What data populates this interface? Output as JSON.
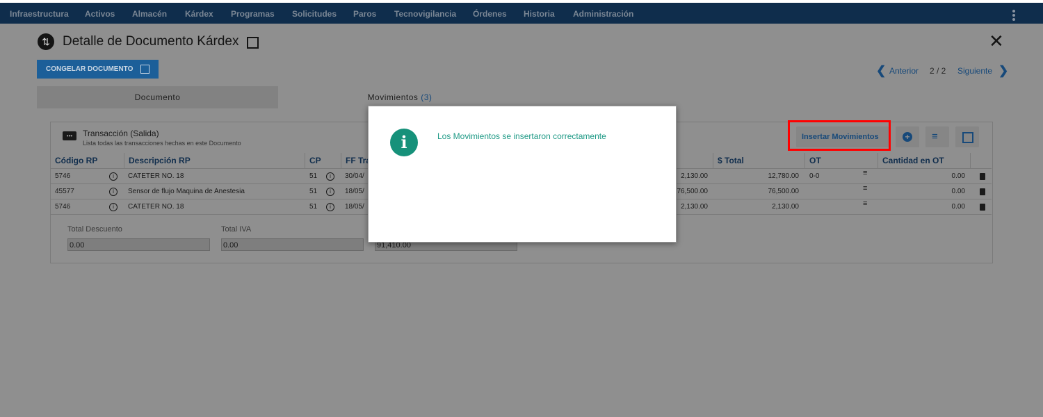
{
  "nav": {
    "items": [
      "Infraestructura",
      "Activos",
      "Almacén",
      "Kárdex",
      "Programas",
      "Solicitudes",
      "Paros",
      "Tecnovigilancia",
      "Órdenes",
      "Historia",
      "Administración"
    ]
  },
  "header": {
    "title": "Detalle de Documento Kárdex",
    "freeze_button": "CONGELAR DOCUMENTO",
    "pager": {
      "prev": "Anterior",
      "count": "2 / 2",
      "next": "Siguiente"
    }
  },
  "tabs": [
    {
      "label": "Documento"
    },
    {
      "label": "Movimientos",
      "count": "(3)"
    }
  ],
  "section": {
    "title": "Transacción (Salida)",
    "subtitle": "Lista todas las transacciones hechas en este Documento",
    "insert_button": "Insertar Movimientos"
  },
  "table": {
    "headers": [
      "Código RP",
      "Descripción RP",
      "CP",
      "FF Tra",
      "$ Total",
      "OT",
      "Cantidad en OT"
    ],
    "rows": [
      {
        "codigo": "5746",
        "descripcion": "CATETER NO. 18",
        "cp": "51",
        "ff": "30/04/",
        "precio": "2,130.00",
        "total": "12,780.00",
        "ot": "0-0",
        "cantidad_ot": "0.00"
      },
      {
        "codigo": "45577",
        "descripcion": "Sensor de flujo Maquina de Anestesia",
        "cp": "51",
        "ff": "18/05/",
        "precio": "76,500.00",
        "total": "76,500.00",
        "ot": "",
        "cantidad_ot": "0.00"
      },
      {
        "codigo": "5746",
        "descripcion": "CATETER NO. 18",
        "cp": "51",
        "ff": "18/05/",
        "precio": "2,130.00",
        "total": "2,130.00",
        "ot": "",
        "cantidad_ot": "0.00"
      }
    ]
  },
  "totals": {
    "descuento_label": "Total Descuento",
    "descuento_value": "0.00",
    "iva_label": "Total IVA",
    "iva_value": "0.00",
    "total_value": "91,410.00"
  },
  "modal": {
    "message": "Los Movimientos se insertaron correctamente"
  },
  "colors": {
    "nav_bg": "#0f2d4c",
    "accent": "#17497a",
    "success": "#16917a",
    "highlight": "#ff0000"
  }
}
